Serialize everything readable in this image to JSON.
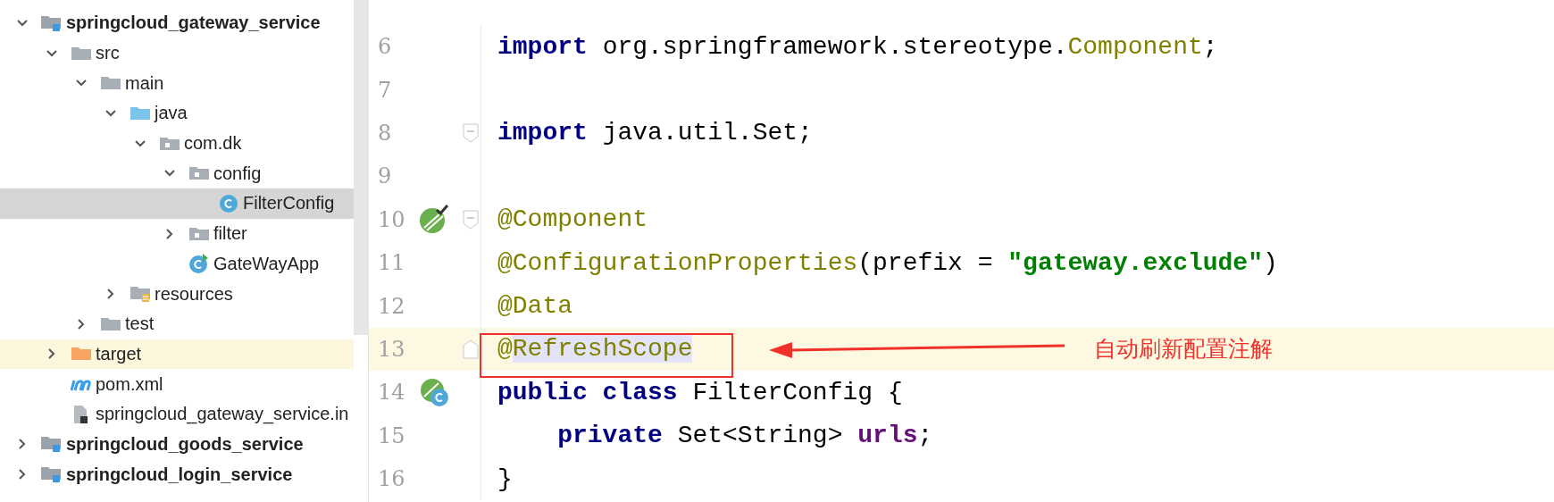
{
  "project_tree": [
    {
      "label": "springcloud_gateway_service",
      "kind": "module",
      "expanded": true,
      "selected": false,
      "highlighted": false,
      "children": [
        {
          "label": "src",
          "kind": "folder",
          "expanded": true,
          "selected": false,
          "highlighted": false,
          "children": [
            {
              "label": "main",
              "kind": "folder",
              "expanded": true,
              "selected": false,
              "highlighted": false,
              "children": [
                {
                  "label": "java",
                  "kind": "source-folder",
                  "expanded": true,
                  "selected": false,
                  "highlighted": false,
                  "children": [
                    {
                      "label": "com.dk",
                      "kind": "package",
                      "expanded": true,
                      "selected": false,
                      "highlighted": false,
                      "children": [
                        {
                          "label": "config",
                          "kind": "package",
                          "expanded": true,
                          "selected": false,
                          "highlighted": false,
                          "children": [
                            {
                              "label": "FilterConfig",
                              "kind": "class",
                              "selected": true,
                              "highlighted": false
                            }
                          ]
                        },
                        {
                          "label": "filter",
                          "kind": "package",
                          "expanded": false,
                          "selected": false,
                          "highlighted": false
                        },
                        {
                          "label": "GateWayApp",
                          "kind": "spring-app",
                          "selected": false,
                          "highlighted": false
                        }
                      ]
                    }
                  ]
                },
                {
                  "label": "resources",
                  "kind": "resources",
                  "expanded": false,
                  "selected": false,
                  "highlighted": false
                }
              ]
            },
            {
              "label": "test",
              "kind": "folder",
              "expanded": false,
              "selected": false,
              "highlighted": false
            }
          ]
        },
        {
          "label": "target",
          "kind": "excluded",
          "expanded": false,
          "selected": false,
          "highlighted": true
        },
        {
          "label": "pom.xml",
          "kind": "maven",
          "selected": false,
          "highlighted": false
        },
        {
          "label": "springcloud_gateway_service.in",
          "kind": "iml",
          "selected": false,
          "highlighted": false
        }
      ]
    },
    {
      "label": "springcloud_goods_service",
      "kind": "module",
      "expanded": false,
      "selected": false,
      "highlighted": false
    },
    {
      "label": "springcloud_login_service",
      "kind": "module",
      "expanded": false,
      "selected": false,
      "highlighted": false
    }
  ],
  "editor": {
    "lines": [
      {
        "number": "6",
        "current": false,
        "tokens": [
          {
            "kind": "keyword",
            "text": "import"
          },
          {
            "kind": "plain",
            "text": " org.springframework.stereotype."
          },
          {
            "kind": "annotation",
            "text": "Component"
          },
          {
            "kind": "plain",
            "text": ";"
          }
        ]
      },
      {
        "number": "7",
        "current": false
      },
      {
        "number": "8",
        "current": false,
        "fold_mark": {
          "kind": "start"
        },
        "tokens": [
          {
            "kind": "keyword",
            "text": "import"
          },
          {
            "kind": "plain",
            "text": " java.util.Set;"
          }
        ]
      },
      {
        "number": "9",
        "current": false
      },
      {
        "number": "10",
        "current": false,
        "gutter_mark": {
          "kind": "bean"
        },
        "fold_mark": {
          "kind": "start"
        },
        "tokens": [
          {
            "kind": "annotation",
            "text": "@Component"
          }
        ]
      },
      {
        "number": "11",
        "current": false,
        "tokens": [
          {
            "kind": "annotation",
            "text": "@ConfigurationProperties"
          },
          {
            "kind": "plain",
            "text": "(prefix = "
          },
          {
            "kind": "string",
            "text": "\"gateway.exclude\""
          },
          {
            "kind": "plain",
            "text": ")"
          }
        ]
      },
      {
        "number": "12",
        "current": false,
        "tokens": [
          {
            "kind": "annotation",
            "text": "@Data"
          }
        ]
      },
      {
        "number": "13",
        "current": true,
        "fold_mark": {
          "kind": "end"
        },
        "tokens": [
          {
            "kind": "annotation",
            "text": "@"
          },
          {
            "kind": "annotation",
            "text": "RefreshScope",
            "highlight": true
          }
        ]
      },
      {
        "number": "14",
        "current": false,
        "gutter_mark": {
          "kind": "class"
        },
        "tokens": [
          {
            "kind": "keyword",
            "text": "public class"
          },
          {
            "kind": "plain",
            "text": " FilterConfig {"
          }
        ]
      },
      {
        "number": "15",
        "current": false,
        "tokens": [
          {
            "kind": "keyword",
            "text": "    private"
          },
          {
            "kind": "plain",
            "text": " Set<String> "
          },
          {
            "kind": "field",
            "text": "urls"
          },
          {
            "kind": "plain",
            "text": ";"
          }
        ]
      },
      {
        "number": "16",
        "current": false,
        "tokens": [
          {
            "kind": "plain",
            "text": "}"
          }
        ]
      }
    ]
  },
  "callout": {
    "text": "自动刷新配置注解"
  }
}
